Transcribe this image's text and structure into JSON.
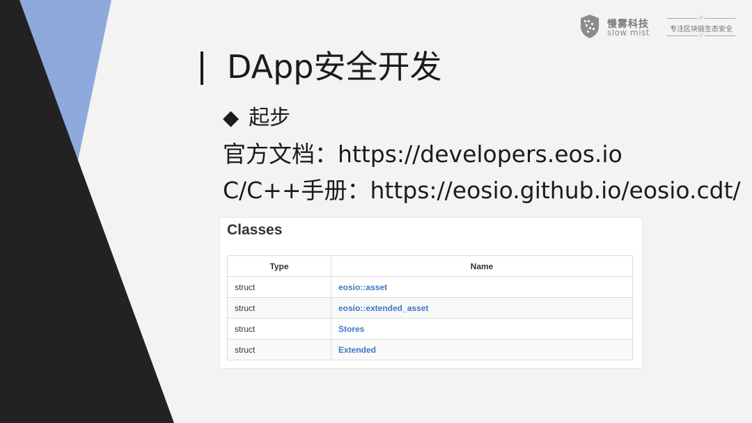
{
  "brand": {
    "name_cn": "慢雾科技",
    "name_en": "slow mist",
    "tagline": "专注区块链生态安全"
  },
  "slide": {
    "title": "DApp安全开发",
    "bullet": "起步",
    "doc_line": "官方文档：https://developers.eos.io",
    "cpp_line": "C/C++手册：https://eosio.github.io/eosio.cdt/"
  },
  "classes": {
    "heading": "Classes",
    "columns": [
      "Type",
      "Name"
    ],
    "rows": [
      {
        "type": "struct",
        "name": "eosio::asset"
      },
      {
        "type": "struct",
        "name": "eosio::extended_asset"
      },
      {
        "type": "struct",
        "name": "Stores"
      },
      {
        "type": "struct",
        "name": "Extended"
      }
    ]
  },
  "colors": {
    "dark_triangle": "#222222",
    "accent_triangle": "#8fa9dc",
    "link": "#3a78c3",
    "background": "#f3f3f3"
  },
  "icons": {
    "bullet": "diamond-icon",
    "logo": "shield-icon"
  }
}
